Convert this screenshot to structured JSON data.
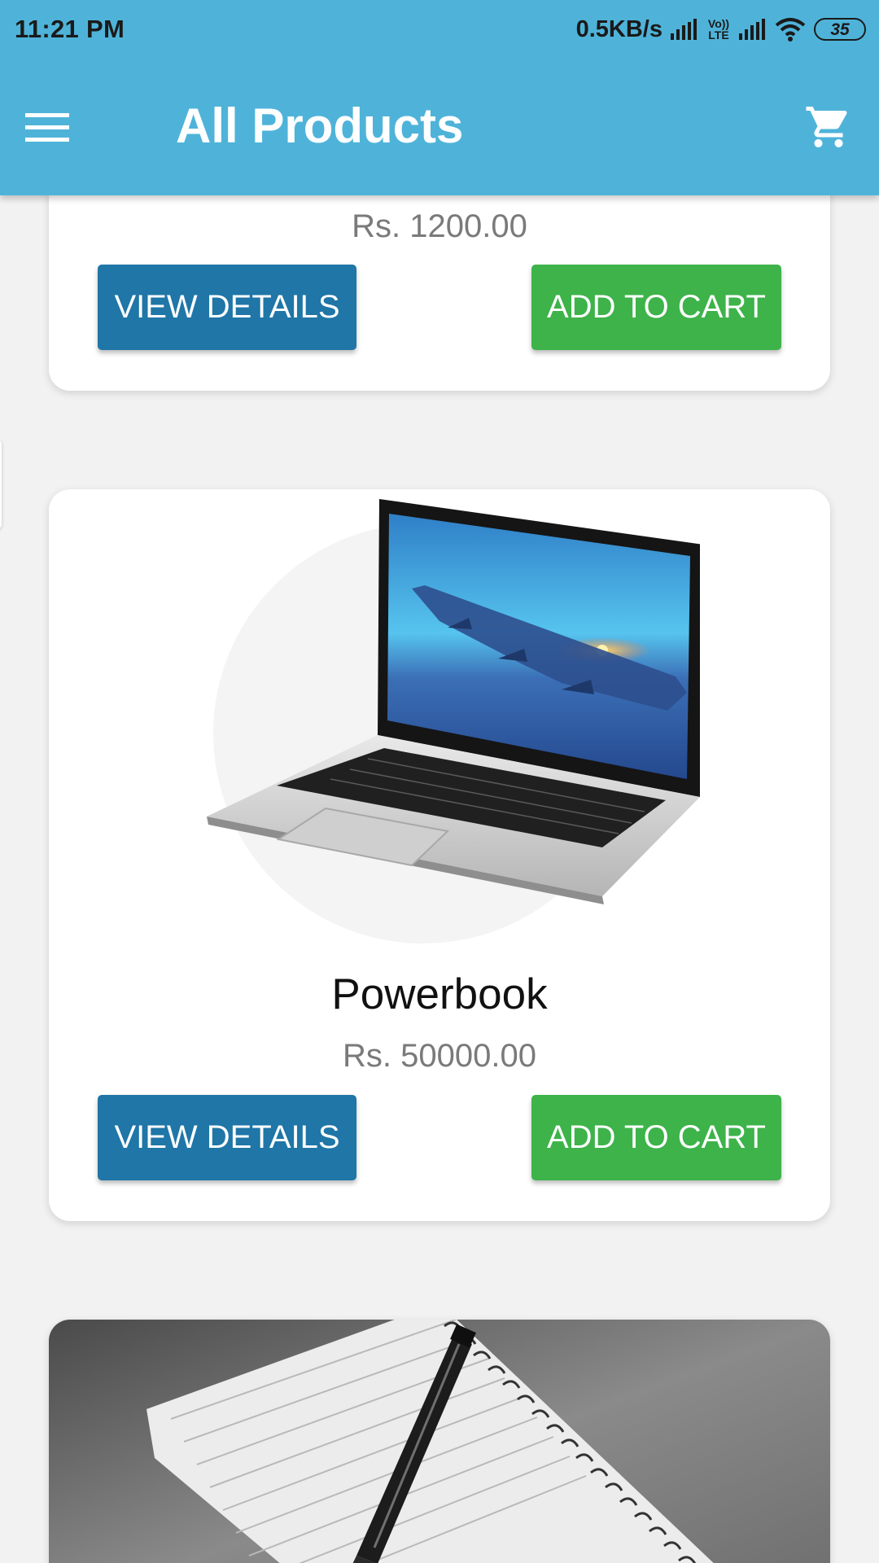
{
  "status_bar": {
    "time": "11:21 PM",
    "network_speed": "0.5KB/s",
    "volte_label": "Vo)) LTE",
    "battery_level": "35"
  },
  "app_bar": {
    "title": "All Products",
    "menu_icon": "hamburger-menu-icon",
    "cart_icon": "shopping-cart-icon"
  },
  "colors": {
    "primary": "#4fb3d9",
    "view_button": "#1f76a7",
    "add_button": "#3db34a"
  },
  "products": [
    {
      "name": "",
      "price": "Rs. 1200.00",
      "view_label": "VIEW DETAILS",
      "add_label": "ADD TO CART"
    },
    {
      "name": "Powerbook",
      "price": "Rs. 50000.00",
      "view_label": "VIEW DETAILS",
      "add_label": "ADD TO CART",
      "image": "laptop"
    },
    {
      "name": "",
      "price": "",
      "image": "notebook-with-pen"
    }
  ]
}
